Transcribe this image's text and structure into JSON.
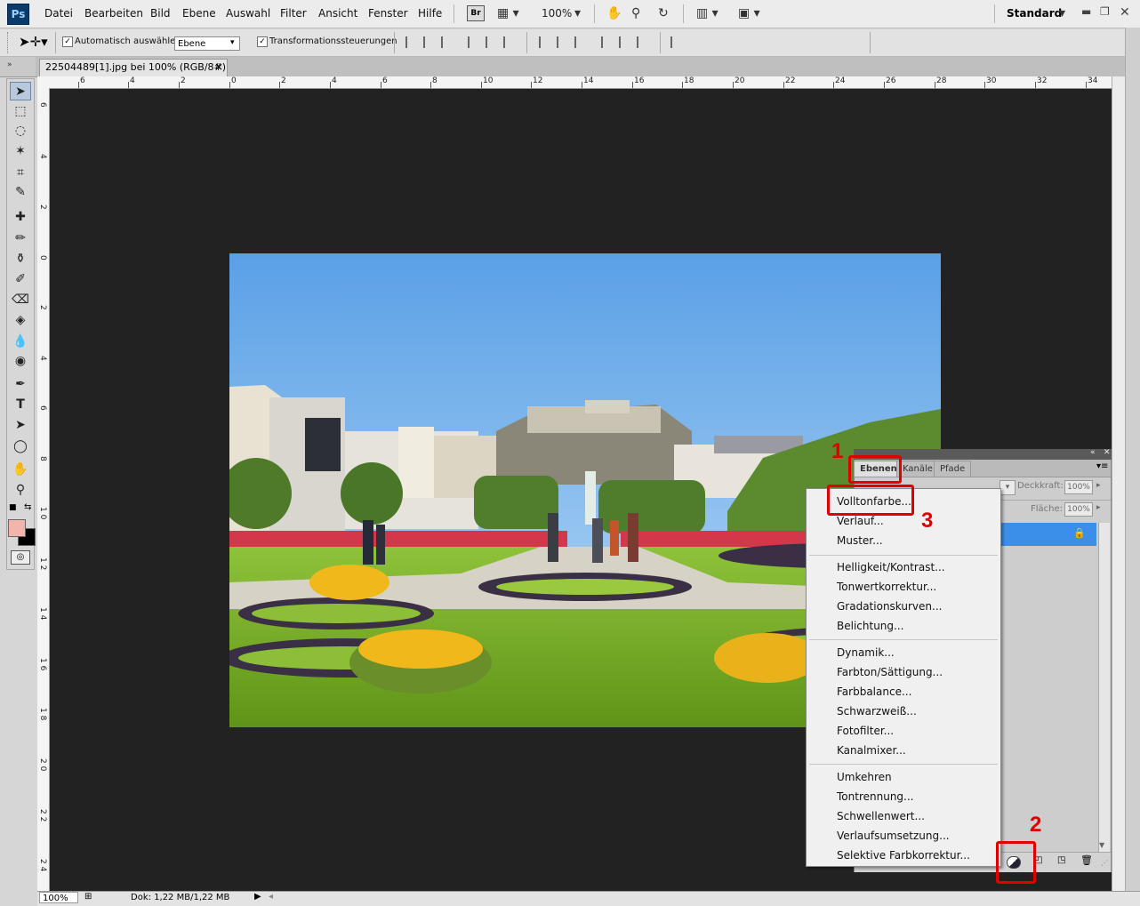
{
  "app": {
    "logo": "Ps",
    "workspace": "Standard",
    "zoom": "100%"
  },
  "menubar": {
    "items": [
      "Datei",
      "Bearbeiten",
      "Bild",
      "Ebene",
      "Auswahl",
      "Filter",
      "Ansicht",
      "Fenster",
      "Hilfe"
    ],
    "br_label": "Br"
  },
  "options": {
    "auto_select_label": "Automatisch auswählen:",
    "auto_select_value": "Ebene",
    "transform_label": "Transformationssteuerungen"
  },
  "document": {
    "tab_title": "22504489[1].jpg bei 100% (RGB/8#)",
    "close": "×"
  },
  "ruler": {
    "top_ticks": [
      "6",
      "4",
      "2",
      "0",
      "2",
      "4",
      "6",
      "8",
      "10",
      "12",
      "14",
      "16",
      "18",
      "20",
      "22",
      "24",
      "26",
      "28",
      "30",
      "32",
      "34"
    ],
    "left_ticks": [
      "6",
      "4",
      "2",
      "0",
      "2",
      "4",
      "6",
      "8",
      "1 0",
      "1 2",
      "1 4",
      "1 6",
      "1 8",
      "2 0",
      "2 2",
      "2 4"
    ]
  },
  "status": {
    "zoom": "100%",
    "doc_info": "Dok: 1,22 MB/1,22 MB"
  },
  "layers_panel": {
    "tabs": [
      "Ebenen",
      "Kanäle",
      "Pfade"
    ],
    "opacity_label": "Deckkraft:",
    "opacity_value": "100%",
    "fill_label": "Fläche:",
    "fill_value": "100%"
  },
  "adjustment_menu": {
    "groups": [
      [
        "Volltonfarbe...",
        "Verlauf...",
        "Muster..."
      ],
      [
        "Helligkeit/Kontrast...",
        "Tonwertkorrektur...",
        "Gradationskurven...",
        "Belichtung..."
      ],
      [
        "Dynamik...",
        "Farbton/Sättigung...",
        "Farbbalance...",
        "Schwarzweiß...",
        "Fotofilter...",
        "Kanalmixer..."
      ],
      [
        "Umkehren",
        "Tontrennung...",
        "Schwellenwert...",
        "Verlaufsumsetzung...",
        "Selektive Farbkorrektur..."
      ]
    ]
  },
  "annotations": {
    "step1": "1",
    "step2": "2",
    "step3": "3"
  },
  "colors": {
    "foreground": "#f2b4ab",
    "background": "#000000",
    "canvas_bg": "#222222",
    "annotation_red": "#e00000",
    "selected_layer": "#3b8fe8"
  }
}
